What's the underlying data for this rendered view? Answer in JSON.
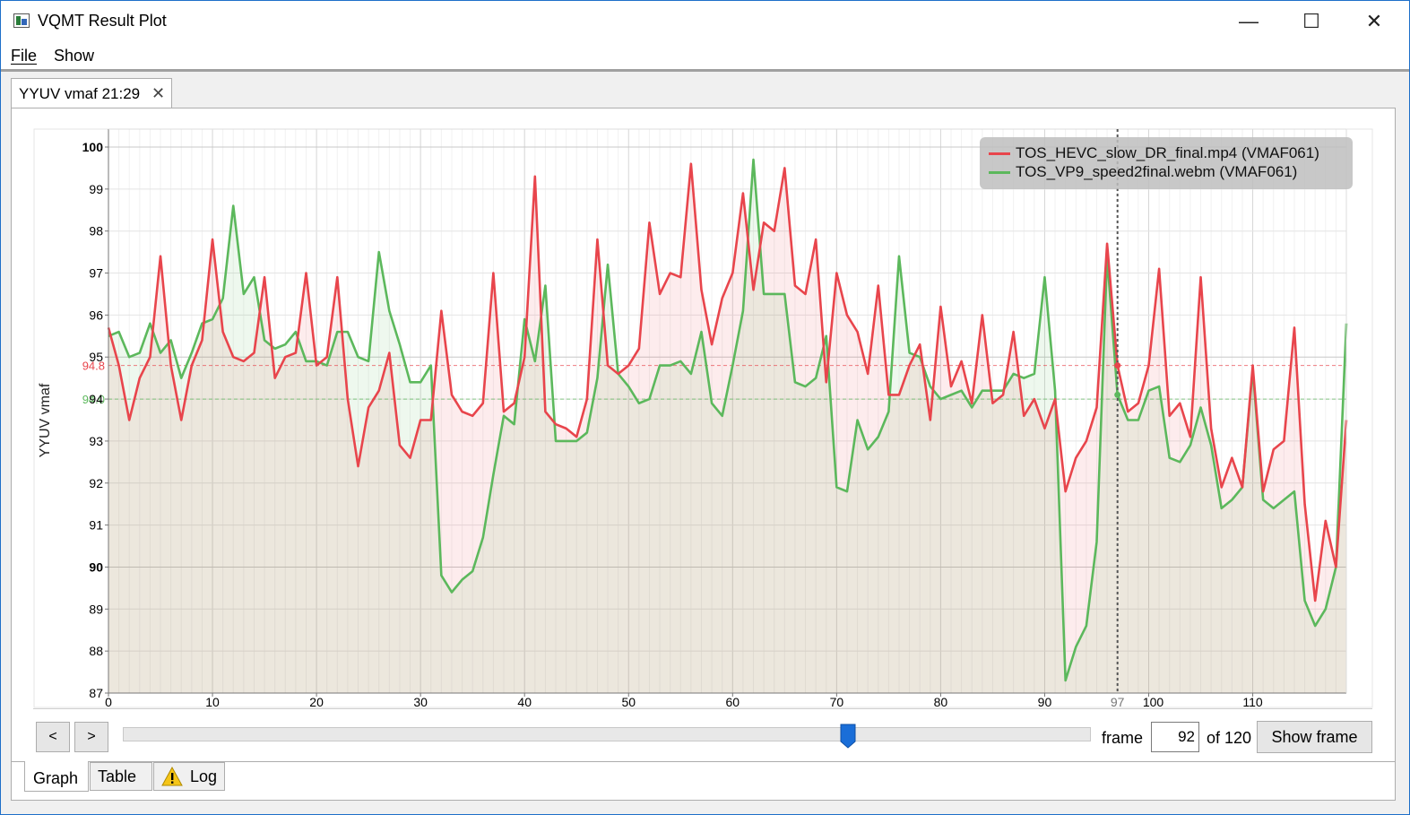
{
  "window": {
    "title": "VQMT Result Plot",
    "min_glyph": "—",
    "max_glyph": "☐",
    "close_glyph": "✕"
  },
  "menu": {
    "file": "File",
    "show": "Show"
  },
  "tab": {
    "label": "YYUV vmaf 21:29",
    "close_glyph": "✕"
  },
  "controls": {
    "prev": "<",
    "next": ">",
    "frame_label": "frame",
    "frame_value": "92",
    "of_label": "of 120",
    "show_frame": "Show frame",
    "slider_value": 92,
    "slider_max": 120
  },
  "bottom_tabs": {
    "graph": "Graph",
    "table": "Table",
    "log": "Log"
  },
  "colors": {
    "red": "#e8454c",
    "green": "#5cb85c",
    "cursor": "#555555"
  },
  "chart_data": {
    "type": "line",
    "ylabel": "YYUV vmaf",
    "xlim": [
      0,
      119
    ],
    "ylim": [
      87,
      100
    ],
    "x_ticks": [
      0,
      10,
      20,
      30,
      40,
      50,
      60,
      70,
      80,
      90,
      100,
      110
    ],
    "y_ticks": [
      87,
      88,
      89,
      90,
      91,
      92,
      93,
      94,
      95,
      96,
      97,
      98,
      99,
      100
    ],
    "cursor_x": 97,
    "legend_position": "top-right",
    "grid": true,
    "series": [
      {
        "name": "TOS_HEVC_slow_DR_final.mp4 (VMAF061)",
        "color": "#e8454c",
        "mean": 94.8,
        "mean_label": "94.8",
        "values": [
          95.7,
          94.8,
          93.5,
          94.5,
          95.0,
          97.4,
          94.8,
          93.5,
          94.8,
          95.4,
          97.8,
          95.6,
          95.0,
          94.9,
          95.1,
          96.9,
          94.5,
          95.0,
          95.1,
          97.0,
          94.8,
          95.0,
          96.9,
          94.0,
          92.4,
          93.8,
          94.2,
          95.1,
          92.9,
          92.6,
          93.5,
          93.5,
          96.1,
          94.1,
          93.7,
          93.6,
          93.9,
          97.0,
          93.7,
          93.9,
          95.0,
          99.3,
          93.7,
          93.4,
          93.3,
          93.1,
          94.0,
          97.8,
          94.8,
          94.6,
          94.8,
          95.2,
          98.2,
          96.5,
          97.0,
          96.9,
          99.6,
          96.6,
          95.3,
          96.4,
          97.0,
          98.9,
          96.6,
          98.2,
          98.0,
          99.5,
          96.7,
          96.5,
          97.8,
          94.4,
          97.0,
          96.0,
          95.6,
          94.6,
          96.7,
          94.1,
          94.1,
          94.8,
          95.3,
          93.5,
          96.2,
          94.3,
          94.9,
          93.9,
          96.0,
          93.9,
          94.1,
          95.6,
          93.6,
          94.0,
          93.3,
          94.0,
          91.8,
          92.6,
          93.0,
          93.8,
          97.7,
          94.8,
          93.7,
          93.9,
          94.8,
          97.1,
          93.6,
          93.9,
          93.1,
          96.9,
          93.3,
          91.9,
          92.6,
          91.9,
          94.8,
          91.8,
          92.8,
          93.0,
          95.7,
          91.5,
          89.2,
          91.1,
          90.0,
          93.5
        ]
      },
      {
        "name": "TOS_VP9_speed2final.webm (VMAF061)",
        "color": "#5cb85c",
        "mean": 94.0,
        "mean_label": "94.0",
        "values": [
          95.5,
          95.6,
          95.0,
          95.1,
          95.8,
          95.1,
          95.4,
          94.5,
          95.1,
          95.8,
          95.9,
          96.4,
          98.6,
          96.5,
          96.9,
          95.4,
          95.2,
          95.3,
          95.6,
          94.9,
          94.9,
          94.8,
          95.6,
          95.6,
          95.0,
          94.9,
          97.5,
          96.1,
          95.3,
          94.4,
          94.4,
          94.8,
          89.8,
          89.4,
          89.7,
          89.9,
          90.7,
          92.2,
          93.6,
          93.4,
          95.9,
          94.9,
          96.7,
          93.0,
          93.0,
          93.0,
          93.2,
          94.5,
          97.2,
          94.6,
          94.3,
          93.9,
          94.0,
          94.8,
          94.8,
          94.9,
          94.6,
          95.6,
          93.9,
          93.6,
          94.8,
          96.1,
          99.7,
          96.5,
          96.5,
          96.5,
          94.4,
          94.3,
          94.5,
          95.5,
          91.9,
          91.8,
          93.5,
          92.8,
          93.1,
          93.7,
          97.4,
          95.1,
          95.0,
          94.3,
          94.0,
          94.1,
          94.2,
          93.8,
          94.2,
          94.2,
          94.2,
          94.6,
          94.5,
          94.6,
          96.9,
          94.2,
          87.3,
          88.1,
          88.6,
          90.6,
          97.4,
          94.1,
          93.5,
          93.5,
          94.2,
          94.3,
          92.6,
          92.5,
          92.9,
          93.8,
          92.9,
          91.4,
          91.6,
          91.9,
          94.7,
          91.6,
          91.4,
          91.6,
          91.8,
          89.2,
          88.6,
          89.0,
          90.0,
          95.8
        ]
      }
    ]
  }
}
